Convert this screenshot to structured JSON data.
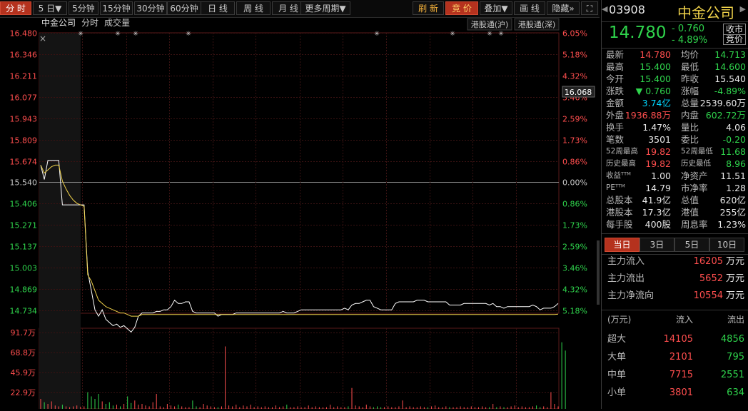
{
  "toolbar": {
    "buttons": [
      "分 时",
      "5 日▼",
      "5分钟",
      "15分钟",
      "30分钟",
      "60分钟",
      "日 线",
      "周 线",
      "月 线",
      "更多周期▼"
    ],
    "right_buttons": [
      "刷 新",
      "竞 价",
      "叠加▼",
      "画 线",
      "隐藏»",
      "⛶"
    ]
  },
  "chart": {
    "title": "中金公司",
    "mode": "分时",
    "volume_label": "成交量",
    "tag_sh": "港股通(沪)",
    "tag_sz": "港股通(深)",
    "cursor_price": "16.068",
    "price_ticks": [
      "16.480",
      "16.346",
      "16.211",
      "16.077",
      "15.943",
      "15.809",
      "15.674",
      "15.540",
      "15.406",
      "15.271",
      "15.137",
      "15.003",
      "14.869",
      "14.734"
    ],
    "pct_ticks": [
      "6.05%",
      "5.18%",
      "4.32%",
      "3.46%",
      "2.59%",
      "1.73%",
      "0.86%",
      "0.00%",
      "0.86%",
      "1.73%",
      "2.59%",
      "3.46%",
      "4.32%",
      "5.18%"
    ],
    "vol_ticks": [
      "91.7万",
      "68.8万",
      "45.9万",
      "22.9万"
    ],
    "colors": {
      "up": "#ff4e4e",
      "down": "#2fd44c",
      "price_line": "#ffffff",
      "avg_line": "#f0d24a",
      "grid": "#3a1212"
    },
    "prev_close": 15.54,
    "price_max": 16.48,
    "price_min": 14.6,
    "vol_max": 917000
  },
  "chart_data": {
    "type": "line",
    "series": [
      {
        "values": [
          15.65,
          15.56,
          15.68,
          15.68,
          15.68,
          15.68,
          15.4,
          15.4,
          15.4,
          15.4,
          15.4,
          15.4,
          15.4,
          14.98,
          14.86,
          14.74,
          14.7,
          14.74,
          14.68,
          14.66,
          14.64,
          14.65,
          14.63,
          14.64,
          14.62,
          14.6,
          14.63,
          14.7,
          14.72,
          14.72,
          14.72,
          14.72,
          14.73,
          14.73,
          14.74,
          14.74,
          14.76,
          14.8,
          14.78,
          14.78,
          14.79,
          14.79,
          14.73,
          14.72,
          14.72,
          14.72,
          14.72,
          14.72,
          14.72,
          14.7,
          14.71,
          14.71,
          14.71,
          14.71,
          14.72,
          14.72,
          14.72,
          14.72,
          14.72,
          14.72,
          14.72,
          14.72,
          14.72,
          14.72,
          14.72,
          14.72,
          14.72,
          14.73,
          14.72,
          14.72,
          14.72,
          14.73,
          14.74,
          14.74,
          14.74,
          14.74,
          14.74,
          14.74,
          14.74,
          14.74,
          14.74,
          14.74,
          14.74,
          14.74,
          14.75,
          14.74,
          14.77,
          14.78,
          14.78,
          14.79,
          14.8,
          14.8,
          14.76,
          14.75,
          14.74,
          14.74,
          14.74,
          14.74,
          14.78,
          14.79,
          14.79,
          14.79,
          14.79,
          14.79,
          14.8,
          14.8,
          14.8,
          14.79,
          14.79,
          14.79,
          14.79,
          14.79,
          14.79,
          14.77,
          14.77,
          14.77,
          14.77,
          14.78,
          14.78,
          14.78,
          14.78,
          14.78,
          14.78,
          14.78,
          14.77,
          14.78,
          14.76,
          14.76,
          14.75,
          14.76,
          14.76,
          14.76,
          14.76,
          14.76,
          14.76,
          14.76,
          14.77,
          14.76,
          14.74,
          14.75,
          14.75,
          14.75,
          14.76,
          14.78
        ]
      },
      {
        "values": [
          15.65,
          15.6,
          15.62,
          15.64,
          15.65,
          15.65,
          15.55,
          15.5,
          15.46,
          15.43,
          15.41,
          15.4,
          15.39,
          14.96,
          14.92,
          14.86,
          14.8,
          14.78,
          14.76,
          14.75,
          14.74,
          14.73,
          14.72,
          14.72,
          14.71,
          14.7,
          14.7,
          14.7,
          14.71,
          14.71,
          14.71,
          14.71,
          14.71,
          14.71,
          14.71,
          14.71,
          14.71,
          14.71,
          14.71,
          14.71,
          14.71,
          14.71,
          14.71,
          14.71,
          14.71,
          14.71,
          14.71,
          14.71,
          14.71,
          14.71,
          14.71,
          14.71,
          14.71,
          14.71,
          14.71,
          14.71,
          14.71,
          14.71,
          14.71,
          14.71,
          14.71,
          14.71,
          14.71,
          14.71,
          14.71,
          14.71,
          14.71,
          14.71,
          14.71,
          14.71,
          14.71,
          14.71,
          14.71,
          14.71,
          14.71,
          14.71,
          14.71,
          14.71,
          14.71,
          14.71,
          14.71,
          14.71,
          14.71,
          14.71,
          14.71,
          14.71,
          14.71,
          14.71,
          14.71,
          14.71,
          14.71,
          14.71,
          14.71,
          14.71,
          14.71,
          14.71,
          14.71,
          14.71,
          14.71,
          14.71,
          14.71,
          14.71,
          14.71,
          14.71,
          14.71,
          14.71,
          14.71,
          14.71,
          14.71,
          14.71,
          14.71,
          14.71,
          14.71,
          14.71,
          14.71,
          14.71,
          14.71,
          14.71,
          14.71,
          14.71,
          14.71,
          14.71,
          14.71,
          14.71,
          14.71,
          14.71,
          14.71,
          14.71,
          14.71,
          14.71,
          14.71,
          14.71,
          14.71,
          14.71,
          14.71,
          14.71,
          14.71,
          14.71,
          14.71,
          14.71,
          14.71,
          14.71,
          14.71,
          14.713
        ]
      }
    ],
    "volumes": [
      120000,
      80000,
      60000,
      90000,
      40000,
      30000,
      50000,
      30000,
      20000,
      30000,
      40000,
      25000,
      30000,
      200000,
      150000,
      120000,
      180000,
      90000,
      60000,
      80000,
      40000,
      50000,
      30000,
      60000,
      150000,
      70000,
      100000,
      50000,
      60000,
      40000,
      30000,
      80000,
      180000,
      30000,
      20000,
      60000,
      40000,
      30000,
      50000,
      30000,
      20000,
      20000,
      100000,
      30000,
      20000,
      60000,
      40000,
      30000,
      20000,
      20000,
      30000,
      750000,
      40000,
      30000,
      50000,
      20000,
      40000,
      30000,
      50000,
      20000,
      30000,
      20000,
      30000,
      20000,
      20000,
      40000,
      20000,
      30000,
      50000,
      20000,
      20000,
      30000,
      20000,
      20000,
      40000,
      20000,
      30000,
      20000,
      20000,
      20000,
      50000,
      20000,
      30000,
      20000,
      20000,
      30000,
      250000,
      40000,
      30000,
      20000,
      50000,
      30000,
      20000,
      30000,
      20000,
      20000,
      30000,
      20000,
      20000,
      30000,
      100000,
      20000,
      30000,
      20000,
      20000,
      30000,
      20000,
      20000,
      30000,
      40000,
      20000,
      20000,
      30000,
      20000,
      20000,
      20000,
      30000,
      20000,
      20000,
      30000,
      20000,
      20000,
      30000,
      20000,
      20000,
      60000,
      20000,
      30000,
      20000,
      20000,
      30000,
      40000,
      20000,
      30000,
      20000,
      20000,
      30000,
      40000,
      20000,
      30000,
      20000,
      200000,
      60000,
      30000,
      800000,
      700000
    ]
  },
  "panel": {
    "code": "03908",
    "name": "中金公司",
    "price": "14.780",
    "change": "- 0.760",
    "change_pct": "- 4.89%",
    "badge1": "收市",
    "badge2": "竞价",
    "rows": [
      [
        "最新",
        "14.780",
        "red",
        "均价",
        "14.713",
        "green"
      ],
      [
        "最高",
        "15.400",
        "green",
        "最低",
        "14.600",
        "green"
      ],
      [
        "今开",
        "15.400",
        "green",
        "昨收",
        "15.540",
        "white"
      ],
      [
        "涨跌",
        "▼ 0.760",
        "green",
        "涨幅",
        "-4.89%",
        "green"
      ],
      [
        "金额",
        "3.74亿",
        "cyan",
        "总量",
        "2539.60万",
        "white"
      ],
      [
        "外盘",
        "1936.88万",
        "red",
        "内盘",
        "602.72万",
        "green"
      ],
      [
        "换手",
        "1.47%",
        "white",
        "量比",
        "4.06",
        "white"
      ],
      [
        "笔数",
        "3501",
        "white",
        "委比",
        "-0.20",
        "green"
      ],
      [
        "52周最高",
        "19.82",
        "red",
        "52周最低",
        "11.68",
        "green"
      ],
      [
        "历史最高",
        "19.82",
        "red",
        "历史最低",
        "8.96",
        "green"
      ],
      [
        "收益ᵀᵀᴹ",
        "1.00",
        "white",
        "净资产",
        "11.51",
        "white"
      ],
      [
        "PEᵀᵀᴹ",
        "14.79",
        "white",
        "市净率",
        "1.28",
        "white"
      ],
      [
        "总股本",
        "41.9亿",
        "white",
        "总值",
        "620亿",
        "white"
      ],
      [
        "港股本",
        "17.3亿",
        "white",
        "港值",
        "255亿",
        "white"
      ],
      [
        "每手股",
        "400股",
        "white",
        "周息率",
        "1.23%",
        "white"
      ]
    ],
    "tabs": [
      "当日",
      "3日",
      "5日",
      "10日"
    ],
    "flows": [
      {
        "label": "主力流入",
        "value": "16205",
        "unit": "万元"
      },
      {
        "label": "主力流出",
        "value": "5652",
        "unit": "万元"
      },
      {
        "label": "主力净流向",
        "value": "10554",
        "unit": "万元"
      }
    ],
    "table_header": [
      "(万元)",
      "流入",
      "流出"
    ],
    "table": [
      [
        "超大",
        "14105",
        "4856"
      ],
      [
        "大单",
        "2101",
        "795"
      ],
      [
        "中单",
        "7715",
        "2551"
      ],
      [
        "小单",
        "3801",
        "634"
      ]
    ]
  }
}
